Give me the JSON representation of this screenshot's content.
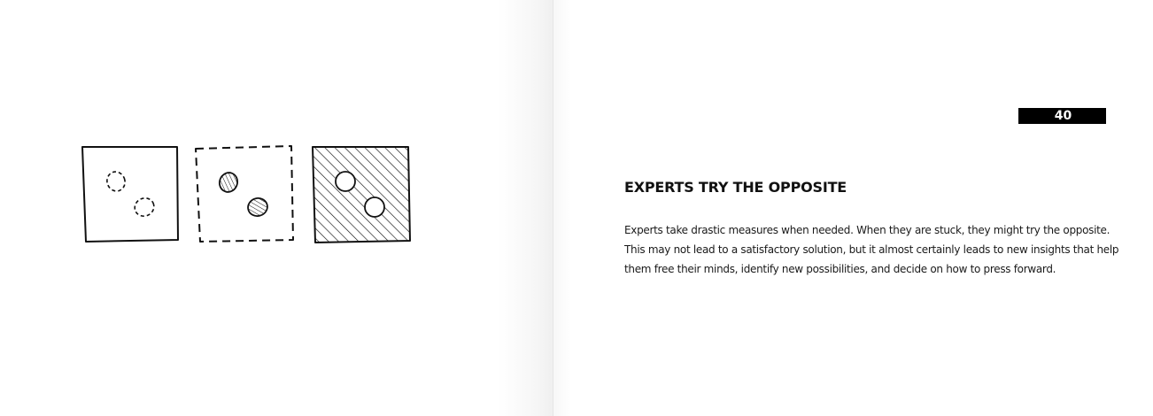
{
  "page_number": "40",
  "heading": "EXPERTS TRY THE OPPOSITE",
  "body_lines": [
    "Experts take drastic measures when needed. When they are stuck, they might try the opposite.",
    "This may not lead to a satisfactory solution, but it almost certainly leads to new insights that help",
    "them free their minds, identify new possibilities, and decide on how to press forward."
  ],
  "illustration": {
    "panels": [
      {
        "name": "solid-square-dashed-circles",
        "border": "solid",
        "fill": "white",
        "dots": "dashed-outline"
      },
      {
        "name": "dashed-square-hatched-circles",
        "border": "dashed",
        "fill": "white",
        "dots": "hatched"
      },
      {
        "name": "hatched-square-white-circles",
        "border": "solid",
        "fill": "hatched",
        "dots": "white"
      }
    ]
  },
  "colors": {
    "ink": "#000000",
    "page": "#ffffff",
    "page_number_bg": "#000000",
    "page_number_text": "#ffffff"
  }
}
